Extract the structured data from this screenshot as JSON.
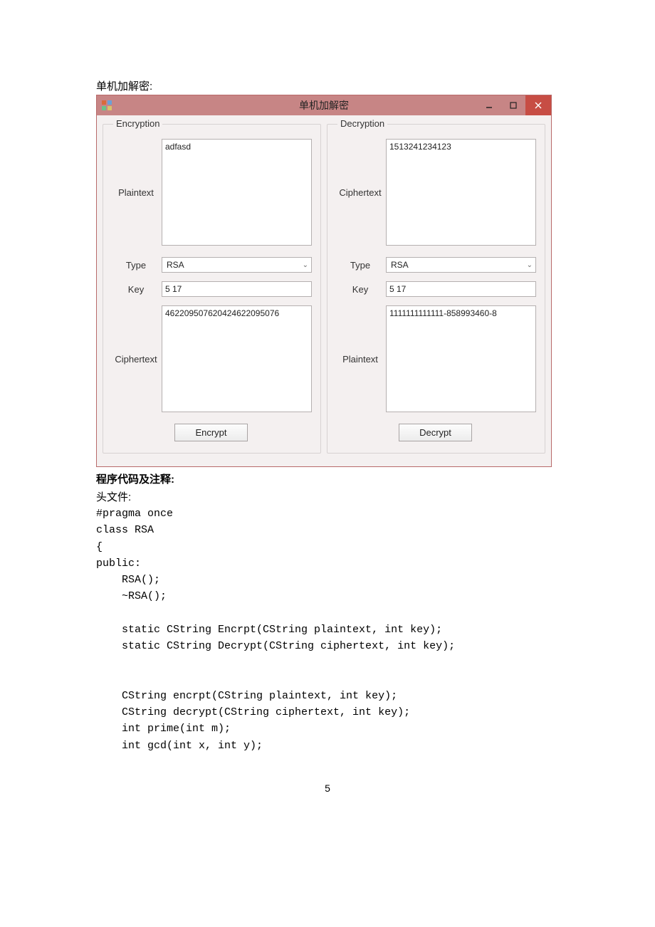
{
  "caption": "单机加解密:",
  "window": {
    "title": "单机加解密"
  },
  "encryption": {
    "legend": "Encryption",
    "plaintext_label": "Plaintext",
    "plaintext_value": "adfasd",
    "type_label": "Type",
    "type_value": "RSA",
    "key_label": "Key",
    "key_value": "5 17",
    "ciphertext_label": "Ciphertext",
    "ciphertext_value": "462209507620424622095076",
    "button": "Encrypt"
  },
  "decryption": {
    "legend": "Decryption",
    "ciphertext_label": "Ciphertext",
    "ciphertext_value": "1513241234123",
    "type_label": "Type",
    "type_value": "RSA",
    "key_label": "Key",
    "key_value": "5 17",
    "plaintext_label": "Plaintext",
    "plaintext_value": "1111111111111-858993460-8",
    "button": "Decrypt"
  },
  "section": {
    "code_heading": "程序代码及注释:",
    "header_file": "头文件:"
  },
  "code": "#pragma once\nclass RSA\n{\npublic:\n    RSA();\n    ~RSA();\n\n    static CString Encrpt(CString plaintext, int key);\n    static CString Decrypt(CString ciphertext, int key);\n\n\n    CString encrpt(CString plaintext, int key);\n    CString decrypt(CString ciphertext, int key);\n    int prime(int m);\n    int gcd(int x, int y);",
  "page_number": "5"
}
